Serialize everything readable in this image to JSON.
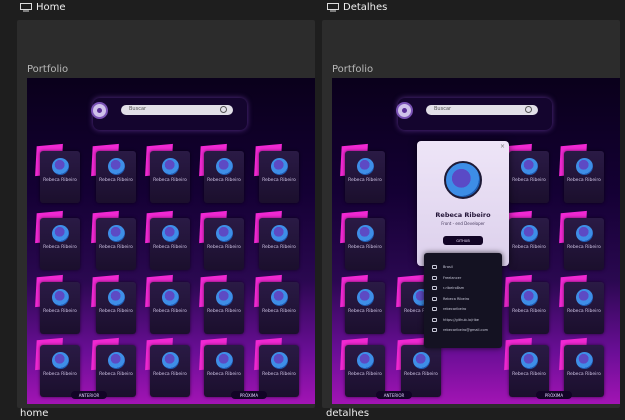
{
  "frames": [
    {
      "tab_title": "Home",
      "board_label": "Portfolio",
      "bottom_label": "home"
    },
    {
      "tab_title": "Detalhes",
      "board_label": "Portfolio",
      "bottom_label": "detalhes"
    }
  ],
  "app": {
    "search_placeholder": "Buscar",
    "card_name": "Rebeca Ribeiro",
    "prev_button": "ANTERIOR",
    "next_button": "PRÓXIMA"
  },
  "detail": {
    "name": "Rebeca Ribeiro",
    "role": "Front - end Developer",
    "button": "GITHUB",
    "contacts": [
      {
        "icon": "location-icon",
        "text": "Brasil"
      },
      {
        "icon": "briefcase-icon",
        "text": "Freelancer"
      },
      {
        "icon": "chat-icon",
        "text": "r-ribeiro8sm"
      },
      {
        "icon": "doc-icon",
        "text": "Rebeca Ribeiro"
      },
      {
        "icon": "building-icon",
        "text": "rebecaribeiro"
      },
      {
        "icon": "link-icon",
        "text": "https://github.io/ribe"
      },
      {
        "icon": "mail-icon",
        "text": "rebecaribeiro@gmail.com"
      }
    ]
  },
  "colors": {
    "accent": "#f028d2",
    "canvas_top": "#0a001b",
    "canvas_bottom": "#a214b4",
    "workspace": "#1e1e1e"
  }
}
